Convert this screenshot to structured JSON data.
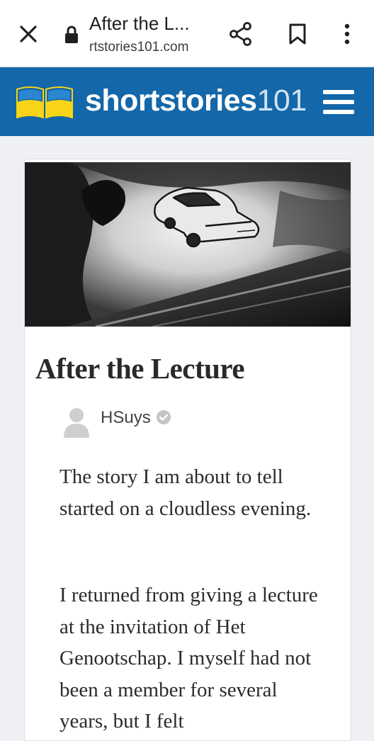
{
  "browser": {
    "page_title": "After the L...",
    "domain": "rtstories101.com",
    "icons": [
      "close-icon",
      "lock-icon",
      "share-icon",
      "bookmark-icon",
      "more-vert-icon"
    ]
  },
  "site": {
    "brand_bold": "shortstories",
    "brand_num": "101",
    "colors": {
      "header_bg": "#1467a8",
      "logo_yellow": "#f7d417",
      "logo_blue": "#1467a8"
    }
  },
  "story": {
    "title": "After the Lecture",
    "author": "HSuys",
    "paragraphs": [
      "The story I am about to tell started on a cloudless evening.",
      "I returned from giving a lecture at the invitation of Het Genootschap. I myself had not been a member for several years, but I felt"
    ]
  }
}
